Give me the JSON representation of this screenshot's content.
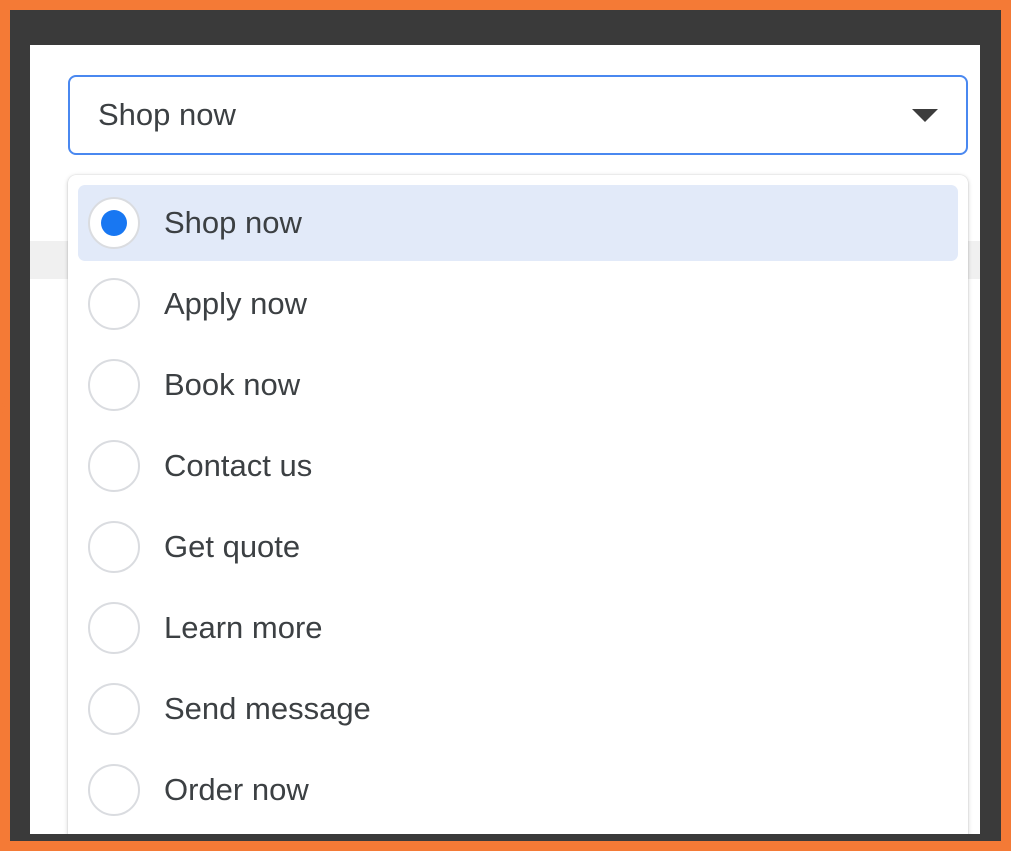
{
  "colors": {
    "outer_border": "#f47a36",
    "frame": "#3a3a3a",
    "select_border": "#4a88f0",
    "selected_bg": "#e2eaf9",
    "radio_fill": "#1877f2",
    "text": "#3c4043"
  },
  "select": {
    "value": "Shop now",
    "icon": "caret-down-icon"
  },
  "options": [
    {
      "label": "Shop now",
      "selected": true
    },
    {
      "label": "Apply now",
      "selected": false
    },
    {
      "label": "Book now",
      "selected": false
    },
    {
      "label": "Contact us",
      "selected": false
    },
    {
      "label": "Get quote",
      "selected": false
    },
    {
      "label": "Learn more",
      "selected": false
    },
    {
      "label": "Send message",
      "selected": false
    },
    {
      "label": "Order now",
      "selected": false
    }
  ]
}
